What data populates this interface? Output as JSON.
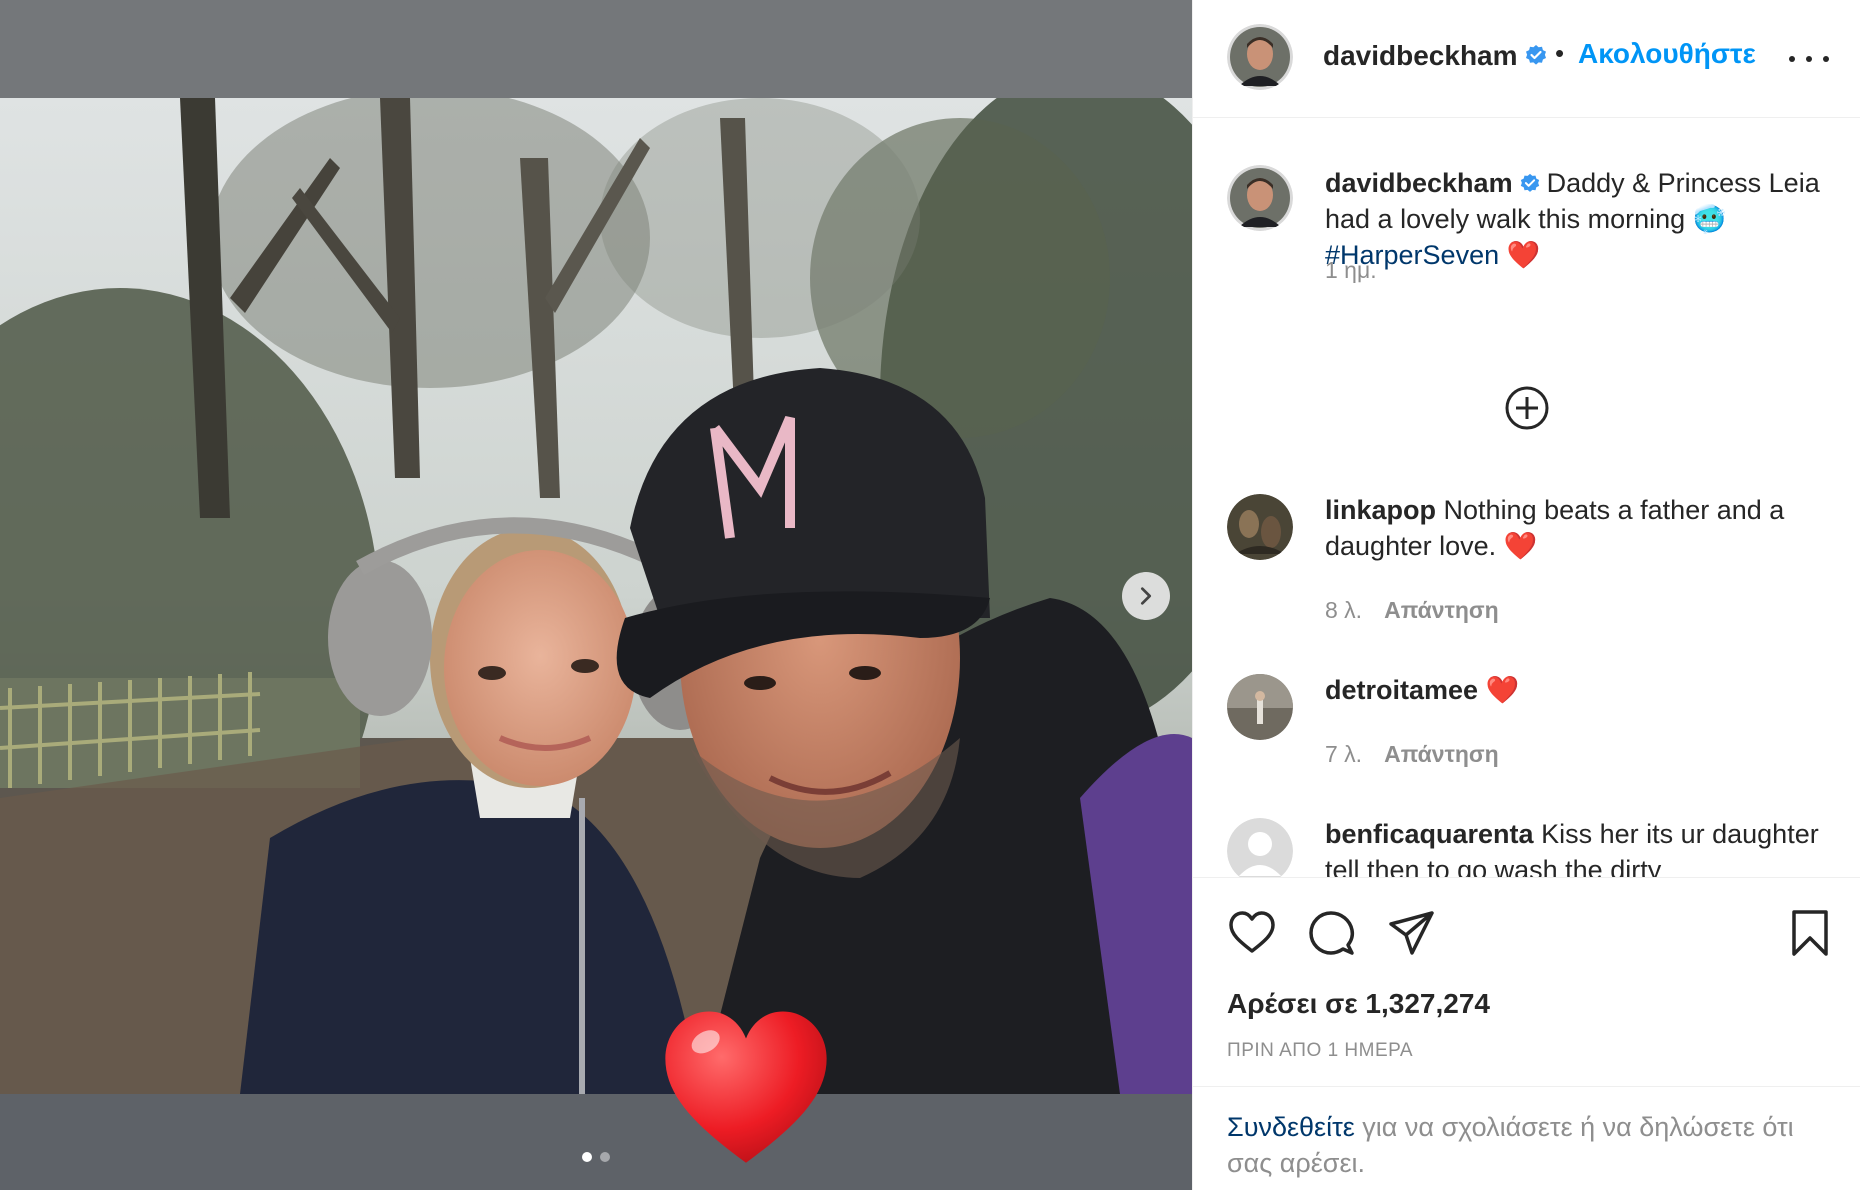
{
  "post": {
    "username": "davidbeckham",
    "separator": "•",
    "follow_label": "Ακολουθήστε",
    "caption_text": "Daddy & Princess Leia had a lovely walk this morning 🥶",
    "caption_hashtag": "#HarperSeven",
    "caption_time": "1 ημ.",
    "likes": "Αρέσει σε 1,327,274",
    "date": "ΠΡΙΝ ΑΠΟ 1 ΗΜΕΡΑ"
  },
  "comments": [
    {
      "username": "linkapop",
      "text": "Nothing beats a father and a daughter love.",
      "time": "8 λ.",
      "reply": "Απάντηση"
    },
    {
      "username": "detroitamee",
      "text": "",
      "time": "7 λ.",
      "reply": "Απάντηση"
    },
    {
      "username": "benficaquarenta",
      "text": "Kiss her its ur daughter tell then to go wash the dirty",
      "time": "",
      "reply": ""
    }
  ],
  "login_prompt": {
    "link": "Συνδεθείτε",
    "text": " για να σχολιάσετε ή να δηλώσετε ότι σας αρέσει."
  },
  "carousel": {
    "current": 1,
    "total": 2
  },
  "icons": [
    "verified-badge-icon",
    "more-options-icon",
    "add-comment-icon",
    "like-heart-icon",
    "comment-icon",
    "share-icon",
    "save-bookmark-icon",
    "carousel-next-icon",
    "heart-emoji-icon"
  ],
  "colors": {
    "accent": "#0095f6",
    "hashtag": "#00376b",
    "text": "#262626",
    "muted": "#8e8e8e",
    "heart": "#ed1c24"
  }
}
